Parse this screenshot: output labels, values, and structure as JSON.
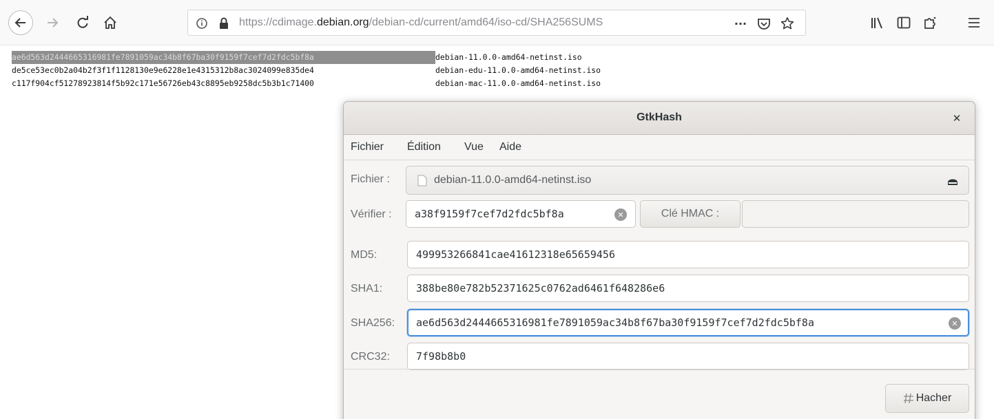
{
  "browser": {
    "url_prefix": "https://cdimage.",
    "url_domain": "debian.org",
    "url_path": "/debian-cd/current/amd64/iso-cd/SHA256SUMS",
    "more_label": "···"
  },
  "icons": {
    "back": "arrow-left-icon",
    "forward": "arrow-right-icon",
    "reload": "reload-icon",
    "home": "home-icon",
    "info": "info-icon",
    "lock": "lock-icon",
    "pocket": "pocket-icon",
    "bookmark": "star-icon",
    "library": "library-icon",
    "sidebar": "sidebar-icon",
    "extension": "extension-icon",
    "menu": "hamburger-menu-icon",
    "disk": "disk-icon",
    "file": "file-icon",
    "hash": "hash-icon"
  },
  "hash_list": [
    {
      "hash": "ae6d563d2444665316981fe7891059ac34b8f67ba30f9159f7cef7d2fdc5bf8a",
      "file": "debian-11.0.0-amd64-netinst.iso",
      "selected": true
    },
    {
      "hash": "de5ce53ec0b2a04b2f3f1f1128130e9e6228e1e4315312b8ac3024099e835de4",
      "file": "debian-edu-11.0.0-amd64-netinst.iso",
      "selected": false
    },
    {
      "hash": "c117f904cf51278923814f5b92c171e56726eb43c8895eb9258dc5b3b1c71400",
      "file": "debian-mac-11.0.0-amd64-netinst.iso",
      "selected": false
    }
  ],
  "gtkhash": {
    "title": "GtkHash",
    "menu": [
      "Fichier",
      "Édition",
      "Vue",
      "Aide"
    ],
    "file_label": "Fichier :",
    "file_name": "debian-11.0.0-amd64-netinst.iso",
    "verify_label": "Vérifier :",
    "verify_value": "a38f9159f7cef7d2fdc5bf8a",
    "hmac_label": "Clé HMAC :",
    "hashes": [
      {
        "label": "MD5:",
        "value": "499953266841cae41612318e65659456"
      },
      {
        "label": "SHA1:",
        "value": "388be80e782b52371625c0762ad6461f648286e6"
      },
      {
        "label": "SHA256:",
        "value": "ae6d563d2444665316981fe7891059ac34b8f67ba30f9159f7cef7d2fdc5bf8a"
      },
      {
        "label": "CRC32:",
        "value": "7f98b8b0"
      }
    ],
    "hash_button": "Hacher"
  }
}
